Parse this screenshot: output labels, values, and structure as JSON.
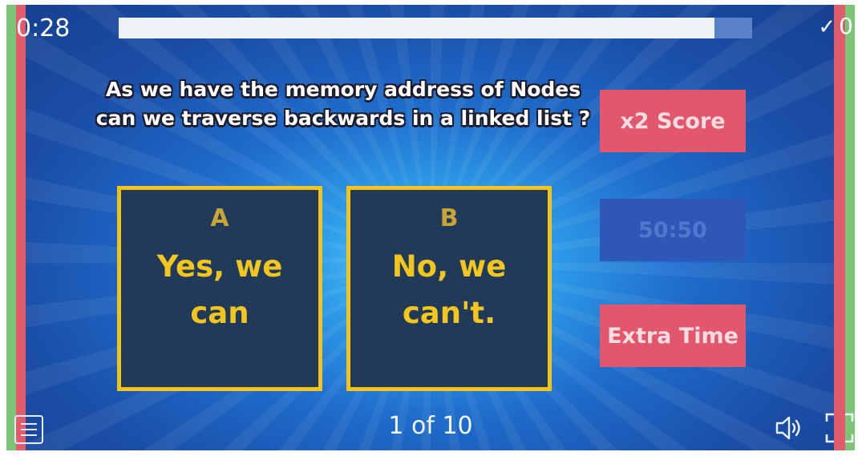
{
  "timer": "0:28",
  "progress": 0.94,
  "correct_count": "0",
  "question": {
    "text": "As we have the memory address of Nodes can we traverse backwards in a linked list ?"
  },
  "answers": [
    {
      "letter": "A",
      "text": "Yes, we can"
    },
    {
      "letter": "B",
      "text": "No, we can't."
    }
  ],
  "powerups": {
    "double_score": "x2 Score",
    "fifty_fifty": "50:50",
    "extra_time": "Extra Time"
  },
  "pagination": "1 of 10",
  "icons": {
    "menu": "menu-icon",
    "sound": "speaker-icon",
    "fullscreen": "fullscreen-icon",
    "correct": "checkmark-icon"
  },
  "colors": {
    "answer_border": "#f0c419",
    "answer_text": "#f3c61e",
    "powerup": "#e2576d",
    "powerup_disabled": "#2f57b8"
  }
}
